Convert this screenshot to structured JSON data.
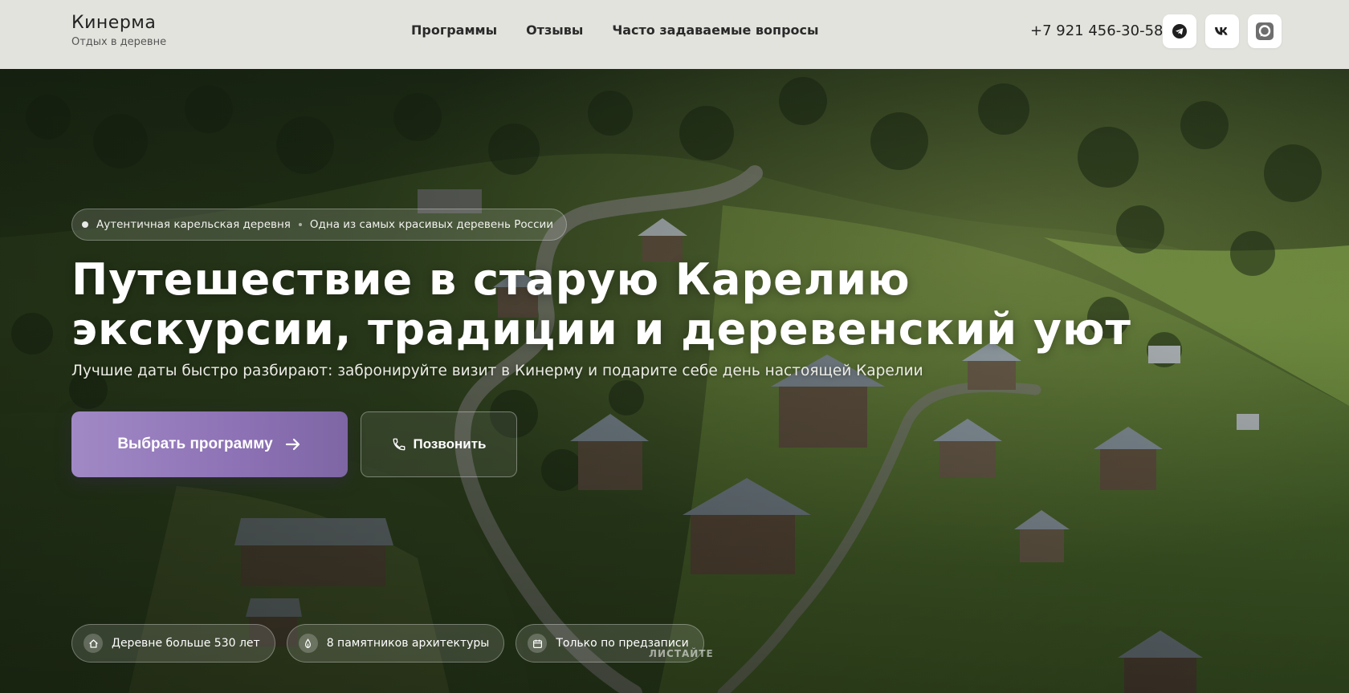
{
  "header": {
    "brand_name": "Кинерма",
    "brand_sub": "Отдых в деревне",
    "nav": [
      {
        "label": "Программы"
      },
      {
        "label": "Отзывы"
      },
      {
        "label": "Часто задаваемые вопросы"
      }
    ],
    "phone": "+7 921 456-30-58",
    "socials": [
      {
        "icon": "telegram-icon"
      },
      {
        "icon": "vk-icon"
      },
      {
        "icon": "max-messenger-icon"
      }
    ]
  },
  "hero": {
    "tagline_1": "Аутентичная карельская деревня",
    "tagline_2": "Одна из самых красивых деревень России",
    "title_line_1": "Путешествие в старую Карелию",
    "title_line_2": "экскурсии, традиции и деревенский уют",
    "subtitle": "Лучшие даты быстро разбирают: забронируйте визит в Кинерму и подарите себе день настоящей Карелии",
    "cta_primary": "Выбрать программу",
    "cta_secondary": "Позвонить",
    "features": [
      {
        "icon": "home-icon",
        "label": "Деревне больше 530 лет"
      },
      {
        "icon": "church-icon",
        "label": "8 памятников архитектуры"
      },
      {
        "icon": "calendar-icon",
        "label": "Только по предзаписи"
      }
    ],
    "scroll_hint": "ЛИСТАЙТЕ"
  },
  "colors": {
    "header_bg": "#e3e3de",
    "accent_purple": "#8d72b5",
    "text_dark": "#222222"
  }
}
